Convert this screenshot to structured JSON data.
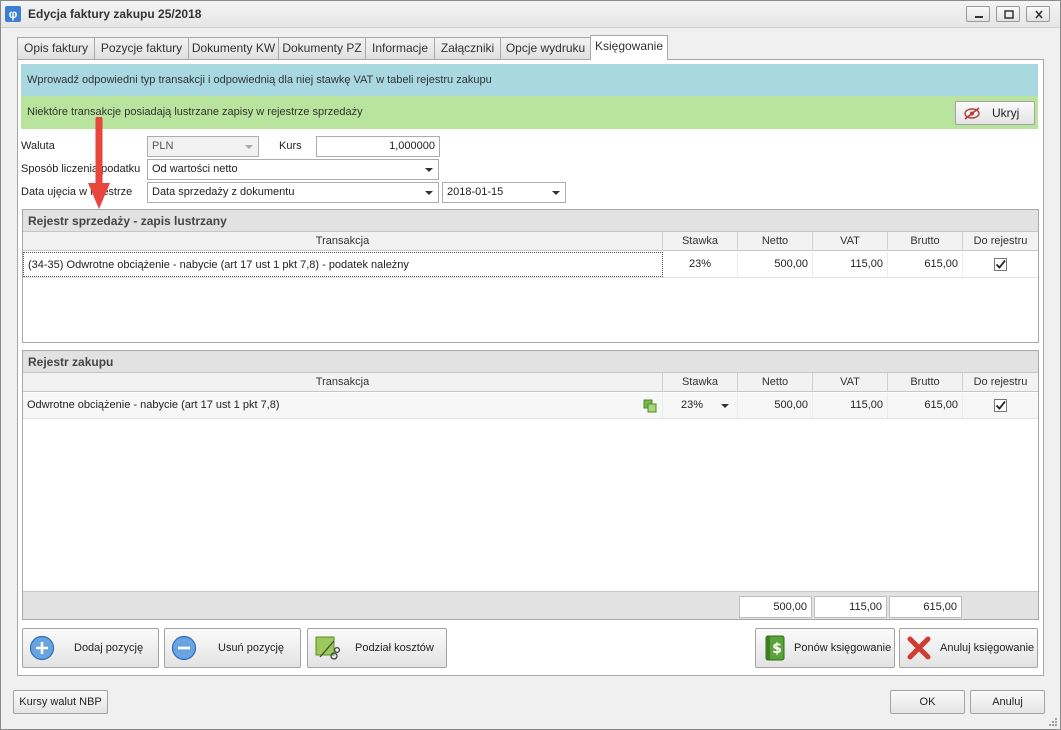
{
  "window": {
    "title": "Edycja faktury zakupu 25/2018",
    "app_icon_glyph": "φ"
  },
  "tabs": [
    {
      "label": "Opis faktury"
    },
    {
      "label": "Pozycje faktury"
    },
    {
      "label": "Dokumenty KW"
    },
    {
      "label": "Dokumenty PZ"
    },
    {
      "label": "Informacje"
    },
    {
      "label": "Załączniki"
    },
    {
      "label": "Opcje wydruku"
    },
    {
      "label": "Księgowanie"
    }
  ],
  "info": {
    "blue_text": "Wprowadź odpowiedni typ transakcji i odpowiednią dla niej stawkę VAT w tabeli rejestru zakupu",
    "green_text": "Niektóre transakcje posiadają lustrzane zapisy w rejestrze sprzedaży",
    "hide_button": "Ukryj"
  },
  "form": {
    "currency_label": "Waluta",
    "currency_value": "PLN",
    "rate_label": "Kurs",
    "rate_value": "1,000000",
    "tax_method_label": "Sposób liczenia podatku",
    "tax_method_value": "Od wartości netto",
    "entry_date_label": "Data ujęcia w rejestrze",
    "entry_date_mode": "Data sprzedaży z dokumentu",
    "entry_date_value": "2018-01-15"
  },
  "sales_register": {
    "title": "Rejestr sprzedaży - zapis lustrzany",
    "columns": [
      "Transakcja",
      "Stawka",
      "Netto",
      "VAT",
      "Brutto",
      "Do rejestru"
    ],
    "rows": [
      {
        "transaction": "(34-35) Odwrotne obciążenie - nabycie (art 17 ust 1 pkt 7,8) - podatek należny",
        "rate": "23%",
        "net": "500,00",
        "vat": "115,00",
        "gross": "615,00",
        "checked": true
      }
    ]
  },
  "purchase_register": {
    "title": "Rejestr zakupu",
    "columns": [
      "Transakcja",
      "Stawka",
      "Netto",
      "VAT",
      "Brutto",
      "Do rejestru"
    ],
    "rows": [
      {
        "transaction": "Odwrotne obciążenie - nabycie (art 17 ust 1 pkt 7,8)",
        "rate": "23%",
        "net": "500,00",
        "vat": "115,00",
        "gross": "615,00",
        "checked": true
      }
    ],
    "totals": {
      "net": "500,00",
      "vat": "115,00",
      "gross": "615,00"
    }
  },
  "actions": {
    "add": "Dodaj pozycję",
    "remove": "Usuń pozycję",
    "split": "Podział kosztów",
    "repost": "Ponów księgowanie",
    "cancel_posting": "Anuluj księgowanie"
  },
  "bottom": {
    "nbp_rates": "Kursy walut NBP",
    "ok": "OK",
    "cancel": "Anuluj"
  },
  "colors": {
    "info_blue": "#a8d8e0",
    "info_green": "#b9e49d",
    "annotation_arrow": "#e8453c"
  }
}
